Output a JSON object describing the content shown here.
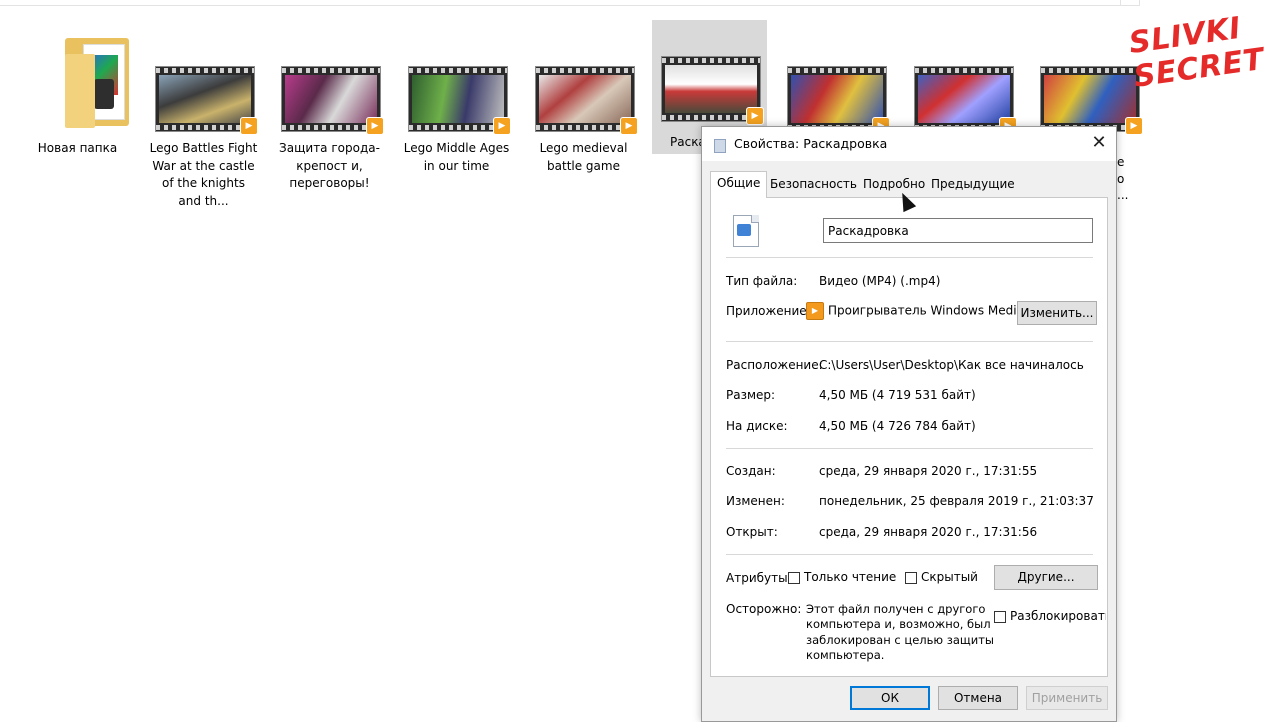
{
  "explorer": {
    "items": [
      {
        "label": "Новая папка",
        "type": "folder"
      },
      {
        "label": "Lego Battles Fight War at the castle of the knights and th...",
        "type": "video"
      },
      {
        "label": "Защита города-крепост и, переговоры!",
        "type": "video"
      },
      {
        "label": "Lego Middle Ages in our time",
        "type": "video"
      },
      {
        "label": "Lego medieval battle game",
        "type": "video"
      },
      {
        "label": "Раска",
        "type": "video",
        "selected": true
      },
      {
        "label": "",
        "type": "video"
      },
      {
        "label": "",
        "type": "video"
      },
      {
        "label": "",
        "type": "video"
      }
    ],
    "partial_labels_right": [
      "e",
      "o",
      "..."
    ]
  },
  "watermark": {
    "line1": "SLIVKI",
    "line2": "SECRET",
    "color": "#e52a2a"
  },
  "dialog": {
    "title": "Свойства: Раскадровка",
    "close_icon": "close-icon",
    "tabs": [
      "Общие",
      "Безопасность",
      "Подробно",
      "Предыдущие версии"
    ],
    "active_tab": "Общие",
    "file_name": "Раскадровка",
    "file_type_label": "Тип файла:",
    "file_type_value": "Видео (MP4) (.mp4)",
    "app_label": "Приложение:",
    "app_value": "Проигрыватель Windows Media",
    "change_button": "Изменить...",
    "location_label": "Расположение:",
    "location_value": "C:\\Users\\User\\Desktop\\Как все начиналось",
    "size_label": "Размер:",
    "size_value": "4,50 МБ (4 719 531 байт)",
    "disk_label": "На диске:",
    "disk_value": "4,50 МБ (4 726 784 байт)",
    "created_label": "Создан:",
    "created_value": "среда, 29 января 2020 г., 17:31:55",
    "modified_label": "Изменен:",
    "modified_value": "понедельник, 25 февраля 2019 г., 21:03:37",
    "opened_label": "Открыт:",
    "opened_value": "среда, 29 января 2020 г., 17:31:56",
    "attributes_label": "Атрибуты:",
    "readonly_label": "Только чтение",
    "hidden_label": "Скрытый",
    "other_button": "Другие...",
    "warning_label": "Осторожно:",
    "warning_line1": "Этот файл получен с другого",
    "warning_line2": "компьютера и, возможно, был",
    "warning_line3": "заблокирован с целью защиты",
    "warning_line4": "компьютера.",
    "unblock_label": "Разблокировать",
    "ok_button": "ОК",
    "cancel_button": "Отмена",
    "apply_button": "Применить"
  }
}
